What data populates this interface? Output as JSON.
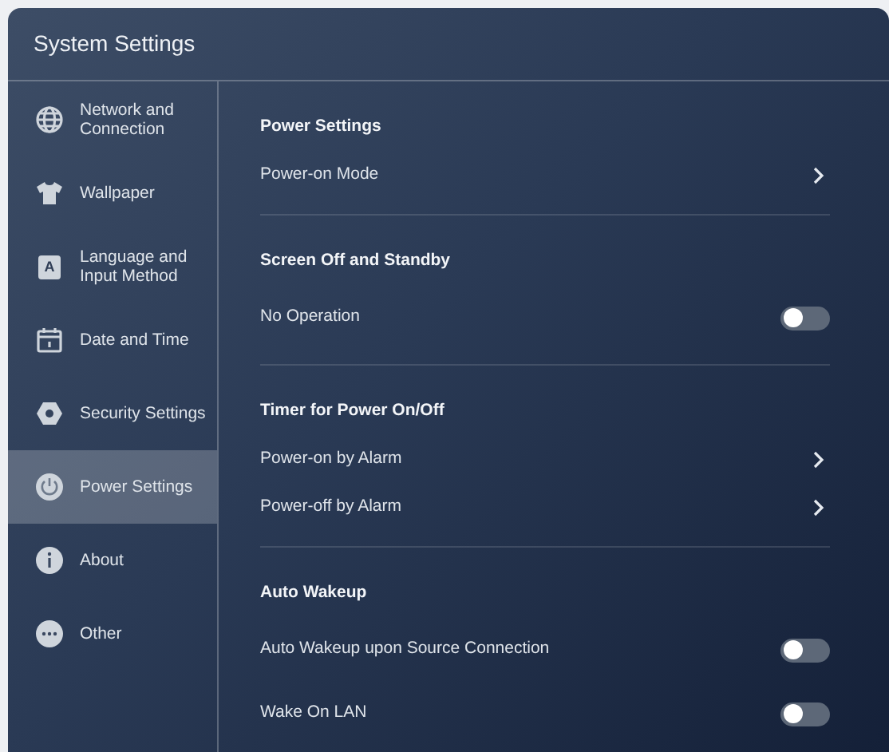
{
  "window": {
    "title": "System Settings"
  },
  "sidebar": {
    "items": [
      {
        "label": "Network and Connection",
        "selected": false
      },
      {
        "label": "Wallpaper",
        "selected": false
      },
      {
        "label": "Language and Input Method",
        "glyph": "A",
        "selected": false
      },
      {
        "label": "Date and Time",
        "selected": false
      },
      {
        "label": "Security Settings",
        "selected": false
      },
      {
        "label": "Power Settings",
        "selected": true
      },
      {
        "label": "About",
        "selected": false
      },
      {
        "label": "Other",
        "selected": false
      }
    ]
  },
  "sections": [
    {
      "heading": "Power Settings",
      "items": [
        {
          "kind": "link",
          "label": "Power-on Mode"
        }
      ]
    },
    {
      "heading": "Screen Off and Standby",
      "items": [
        {
          "kind": "toggle",
          "label": "No Operation",
          "on": false
        }
      ]
    },
    {
      "heading": "Timer for Power On/Off",
      "items": [
        {
          "kind": "link",
          "label": "Power-on by Alarm"
        },
        {
          "kind": "link",
          "label": "Power-off by Alarm"
        }
      ]
    },
    {
      "heading": "Auto Wakeup",
      "items": [
        {
          "kind": "toggle",
          "label": "Auto Wakeup upon Source Connection",
          "on": false
        },
        {
          "kind": "toggle",
          "label": "Wake On LAN",
          "on": false
        }
      ]
    }
  ]
}
